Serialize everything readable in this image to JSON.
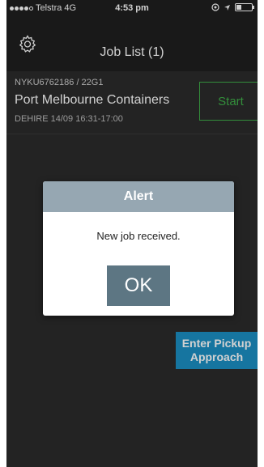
{
  "status_bar": {
    "carrier": "Telstra",
    "network": "4G",
    "time": "4:53 pm"
  },
  "nav": {
    "title": "Job List (1)",
    "settings_icon": "gear-icon"
  },
  "job": {
    "reference": "NYKU6762186 / 22G1",
    "name": "Port Melbourne Containers",
    "meta": "DEHIRE  14/09 16:31-17:00",
    "start_label": "Start"
  },
  "pickup": {
    "label_line1": "Enter Pickup",
    "label_line2": "Approach"
  },
  "alert": {
    "title": "Alert",
    "message": "New job received.",
    "ok_label": "OK"
  },
  "colors": {
    "start_border": "#3fae49",
    "pickup_bg": "#1b8fc4",
    "alert_header": "#96a7b2",
    "ok_bg": "#5d7683"
  }
}
